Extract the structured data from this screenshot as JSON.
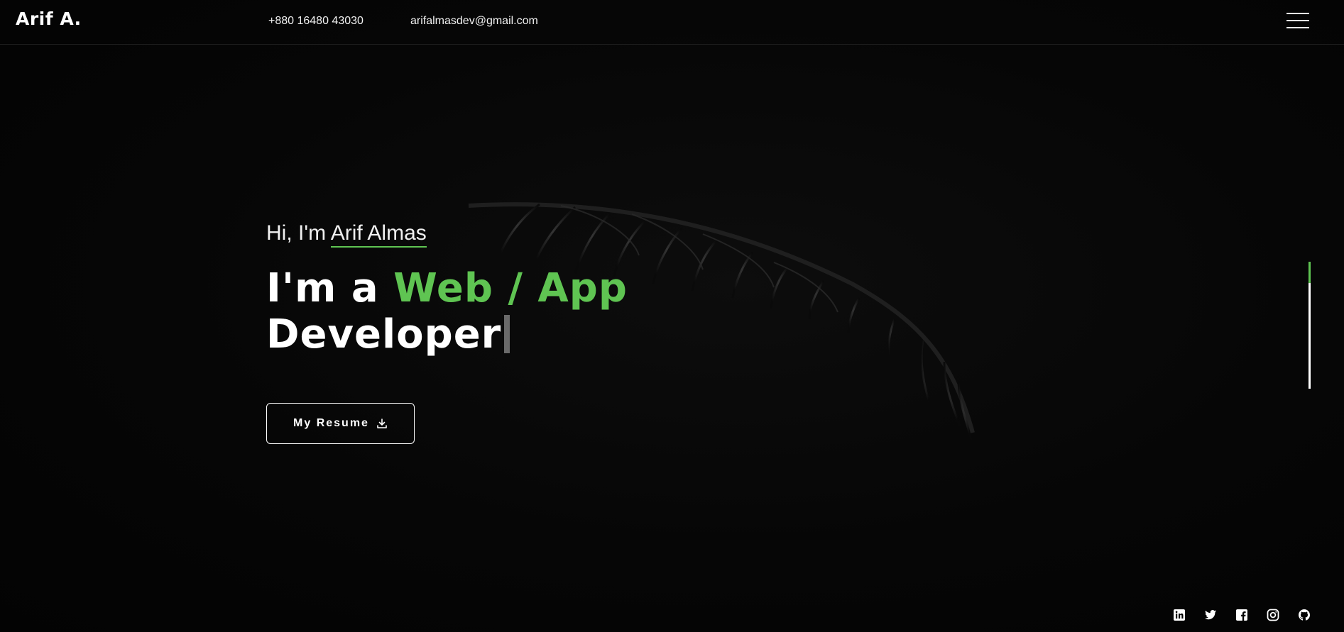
{
  "header": {
    "brand": "Arif A.",
    "phone": "+880 16480 43030",
    "email": "arifalmasdev@gmail.com",
    "menu_icon": "hamburger-icon"
  },
  "hero": {
    "greeting_prefix": "Hi, I'm ",
    "greeting_name": "Arif Almas",
    "headline_prefix": "I'm a ",
    "headline_accent": "Web / App",
    "headline_suffix": "Developer",
    "resume_label": "My Resume",
    "resume_icon": "download-icon"
  },
  "scroll_indicator": {
    "progress": 0.17
  },
  "socials": [
    {
      "icon": "linkedin-icon"
    },
    {
      "icon": "twitter-icon"
    },
    {
      "icon": "facebook-icon"
    },
    {
      "icon": "instagram-icon"
    },
    {
      "icon": "github-icon"
    }
  ],
  "colors": {
    "accent": "#5fc452",
    "background": "#050505",
    "text": "#ffffff"
  }
}
